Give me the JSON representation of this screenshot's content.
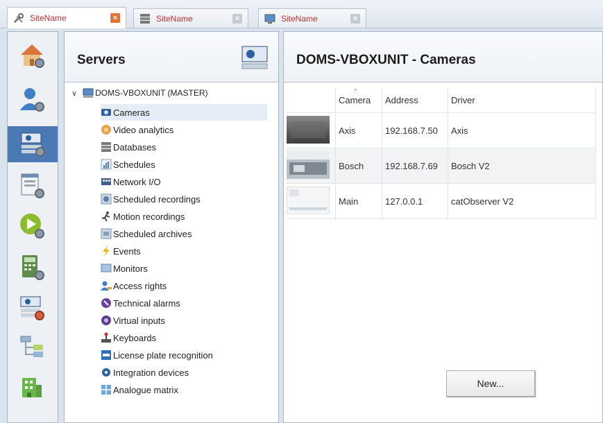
{
  "tabs": [
    {
      "label": "SiteName",
      "icon": "tools-icon"
    },
    {
      "label": "SiteName",
      "icon": "server-rack-icon"
    },
    {
      "label": "SiteName",
      "icon": "monitor-icon"
    }
  ],
  "sidebar": {
    "items": [
      {
        "name": "home-gear-icon"
      },
      {
        "name": "user-gear-icon"
      },
      {
        "name": "server-gear-icon"
      },
      {
        "name": "window-gear-icon"
      },
      {
        "name": "play-gear-icon"
      },
      {
        "name": "keypad-gear-icon"
      },
      {
        "name": "server-record-icon"
      },
      {
        "name": "network-tree-icon"
      },
      {
        "name": "building-icon"
      }
    ]
  },
  "servers_panel": {
    "title": "Servers",
    "root_label": "DOMS-VBOXUNIT (MASTER)",
    "items": [
      {
        "label": "Cameras"
      },
      {
        "label": "Video analytics"
      },
      {
        "label": "Databases"
      },
      {
        "label": "Schedules"
      },
      {
        "label": "Network I/O"
      },
      {
        "label": "Scheduled recordings"
      },
      {
        "label": "Motion recordings"
      },
      {
        "label": "Scheduled archives"
      },
      {
        "label": "Events"
      },
      {
        "label": "Monitors"
      },
      {
        "label": "Access rights"
      },
      {
        "label": "Technical alarms"
      },
      {
        "label": "Virtual inputs"
      },
      {
        "label": "Keyboards"
      },
      {
        "label": "License plate recognition"
      },
      {
        "label": "Integration devices"
      },
      {
        "label": "Analogue matrix"
      }
    ]
  },
  "cameras_panel": {
    "title": "DOMS-VBOXUNIT - Cameras",
    "columns": [
      "Camera",
      "Address",
      "Driver"
    ],
    "rows": [
      {
        "camera": "Axis",
        "address": "192.168.7.50",
        "driver": "Axis"
      },
      {
        "camera": "Bosch",
        "address": "192.168.7.69",
        "driver": "Bosch V2"
      },
      {
        "camera": "Main",
        "address": "127.0.0.1",
        "driver": "catObserver V2"
      }
    ],
    "new_button": "New..."
  }
}
